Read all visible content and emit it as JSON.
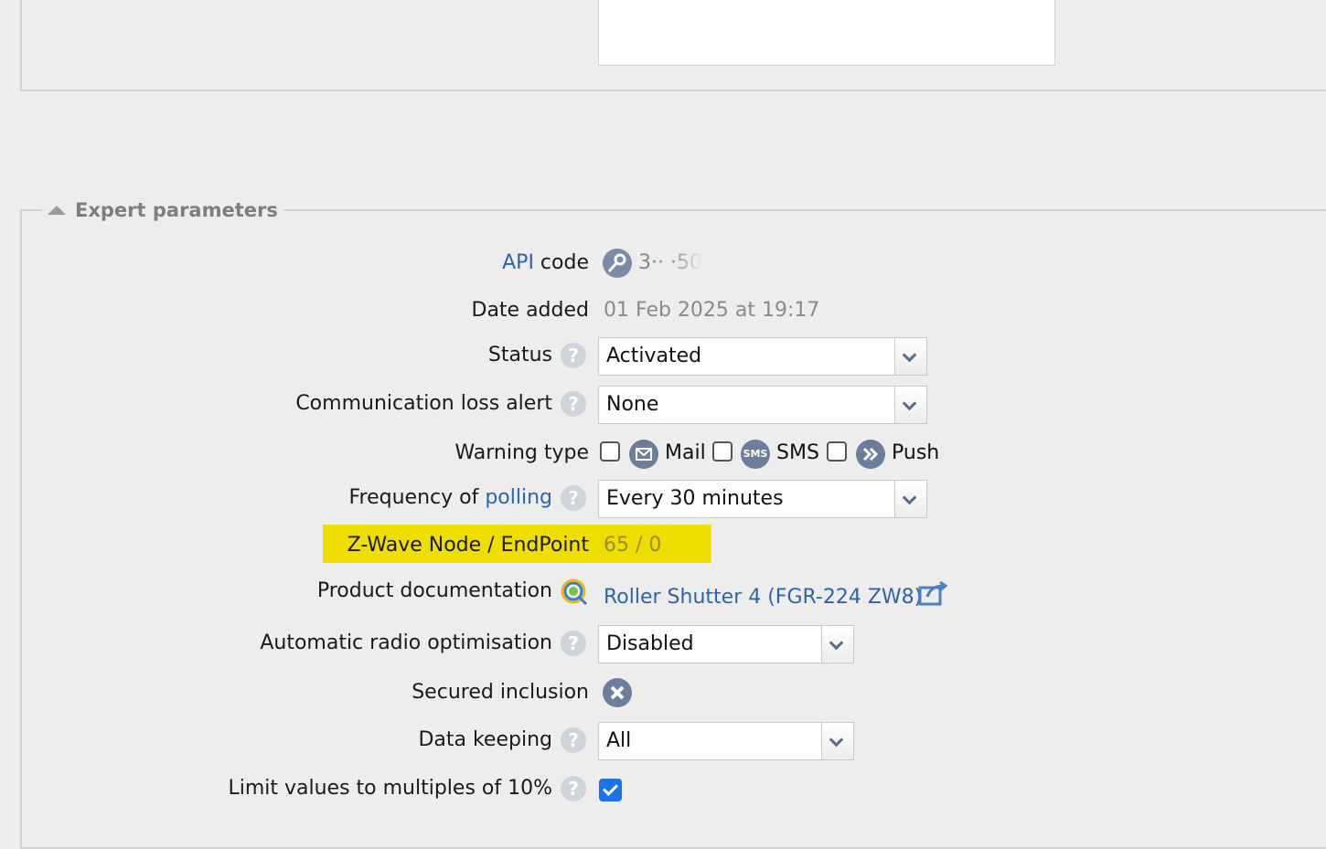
{
  "section": {
    "title": "Expert parameters"
  },
  "api_code": {
    "link": "API",
    "label": " code",
    "value": "3·· ·50·"
  },
  "date_added": {
    "label": "Date added",
    "value": "01 Feb 2025 at 19:17"
  },
  "status": {
    "label": "Status",
    "value": "Activated"
  },
  "comm_loss": {
    "label": "Communication loss alert",
    "value": "None"
  },
  "warning_type": {
    "label": "Warning type",
    "options": [
      {
        "label": "Mail",
        "icon": "mail-icon",
        "checked": false
      },
      {
        "label": "SMS",
        "icon": "sms-icon",
        "icon_text": "SMS",
        "checked": false
      },
      {
        "label": "Push",
        "icon": "push-icon",
        "checked": false
      }
    ]
  },
  "polling": {
    "label": "Frequency of ",
    "link": "polling",
    "value": "Every 30 minutes"
  },
  "zwave": {
    "label": "Z-Wave Node / EndPoint",
    "value": "65 / 0",
    "highlight_color": "#eedf00"
  },
  "product_doc": {
    "label": "Product documentation",
    "value": "Roller Shutter 4 (FGR-224 ZW8)"
  },
  "radio_opt": {
    "label": "Automatic radio optimisation",
    "value": "Disabled"
  },
  "secured": {
    "label": "Secured inclusion",
    "value": false
  },
  "data_keeping": {
    "label": "Data keeping",
    "value": "All"
  },
  "limit": {
    "label": "Limit values to multiples of 10%",
    "checked": true
  },
  "colors": {
    "link": "#2f63a8",
    "accent": "#1a73e8",
    "background": "#ededed"
  }
}
